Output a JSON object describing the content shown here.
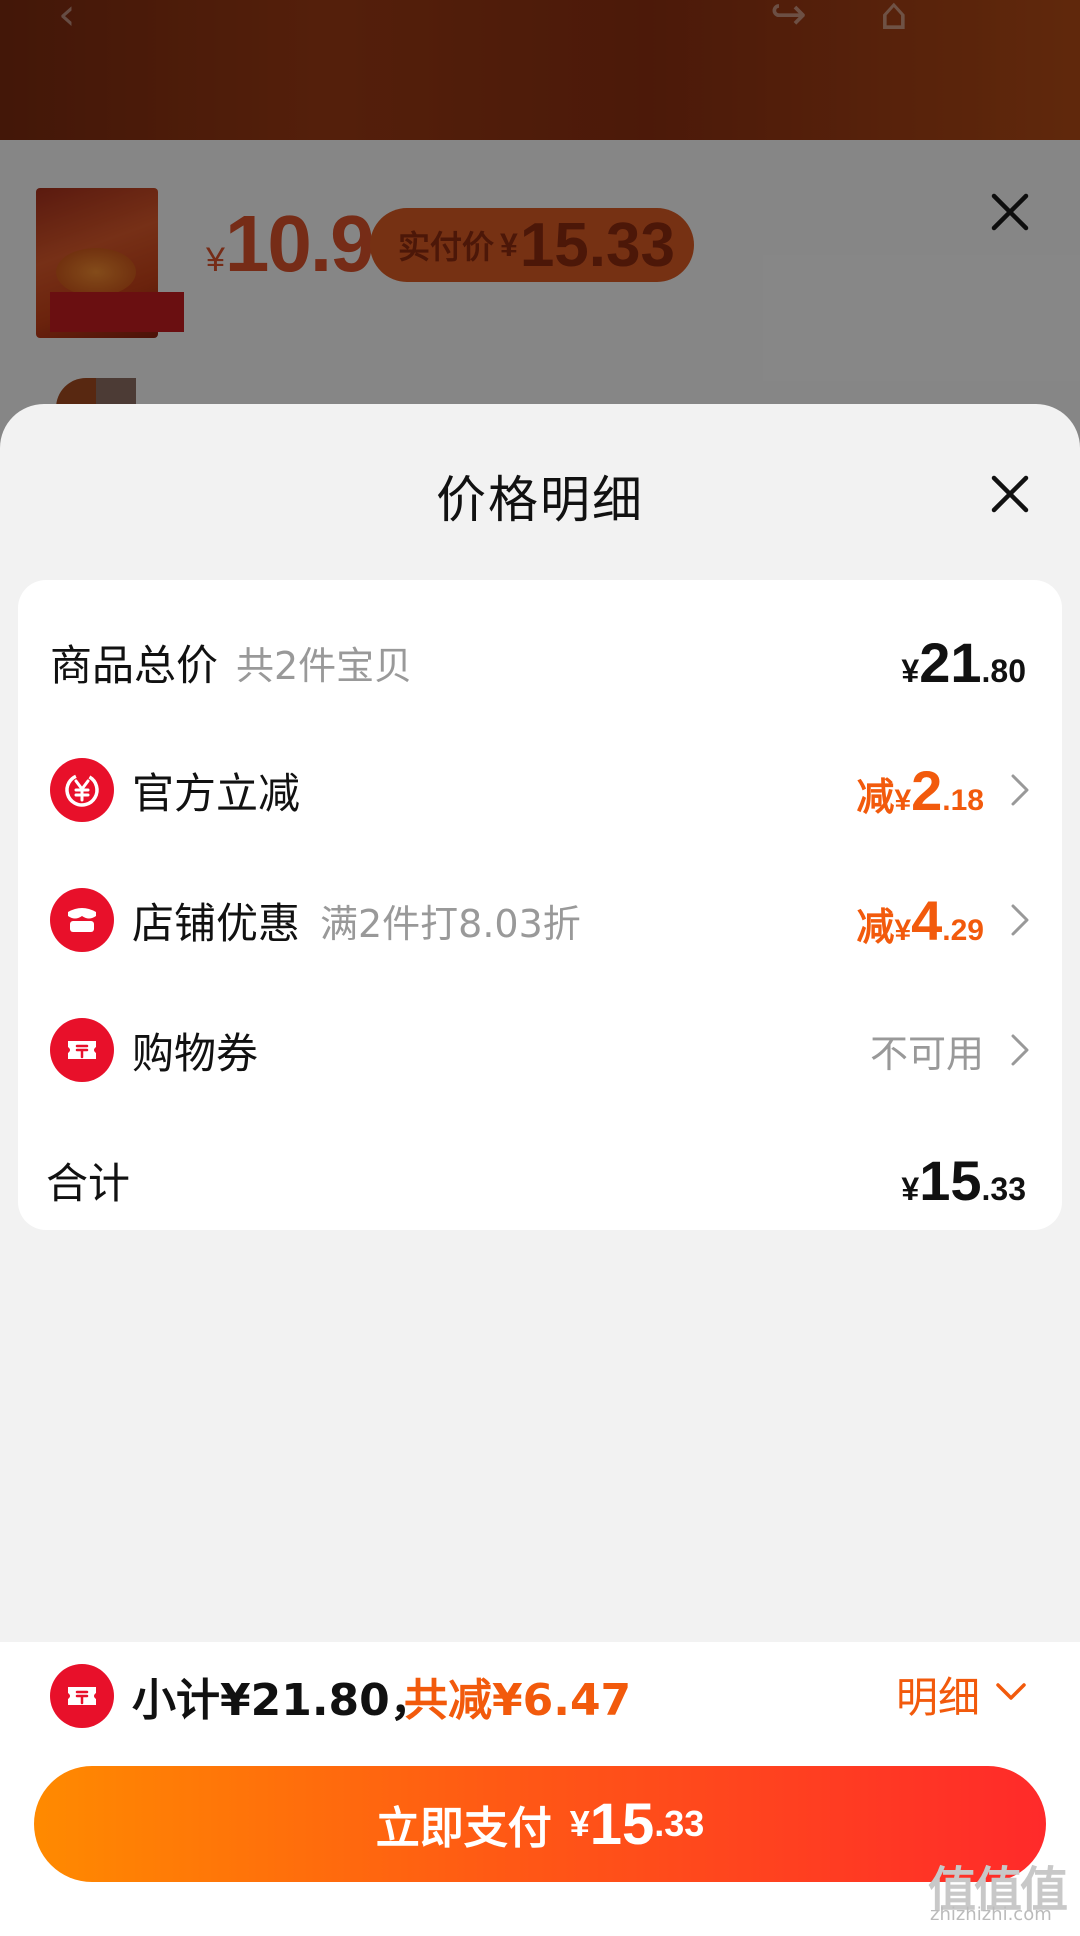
{
  "background": {
    "product_price": {
      "currency": "¥",
      "value": "10.9"
    },
    "real_price": {
      "label": "实付价",
      "currency": "¥",
      "value": "15.33"
    }
  },
  "sheet": {
    "title": "价格明细",
    "rows": {
      "total": {
        "label": "商品总价",
        "sub": "共2件宝贝",
        "currency": "¥",
        "int": "21",
        "dec": ".80"
      },
      "official": {
        "label": "官方立减",
        "prefix": "减",
        "currency": "¥",
        "int": "2",
        "dec": ".18",
        "icon": "yuan-coupon-icon"
      },
      "shop": {
        "label": "店铺优惠",
        "sub": "满2件打8.03折",
        "prefix": "减",
        "currency": "¥",
        "int": "4",
        "dec": ".29",
        "icon": "store-icon"
      },
      "voucher": {
        "label": "购物券",
        "status": "不可用",
        "icon": "ticket-icon"
      },
      "sum": {
        "label": "合计",
        "currency": "¥",
        "int": "15",
        "dec": ".33"
      }
    }
  },
  "bottom_bar": {
    "subtotal": "小计¥21.80，",
    "saved": "共减¥6.47",
    "detail_label": "明细",
    "pay_button": {
      "label": "立即支付",
      "currency": "¥",
      "int": "15",
      "dec": ".33"
    }
  },
  "watermark": {
    "logo": "值值值",
    "site": "zhizhizhi.com"
  },
  "colors": {
    "accent": "#f25a0c",
    "icon_red": "#e8102a",
    "button_start": "#ff8a00",
    "button_end": "#ff2a2a"
  }
}
